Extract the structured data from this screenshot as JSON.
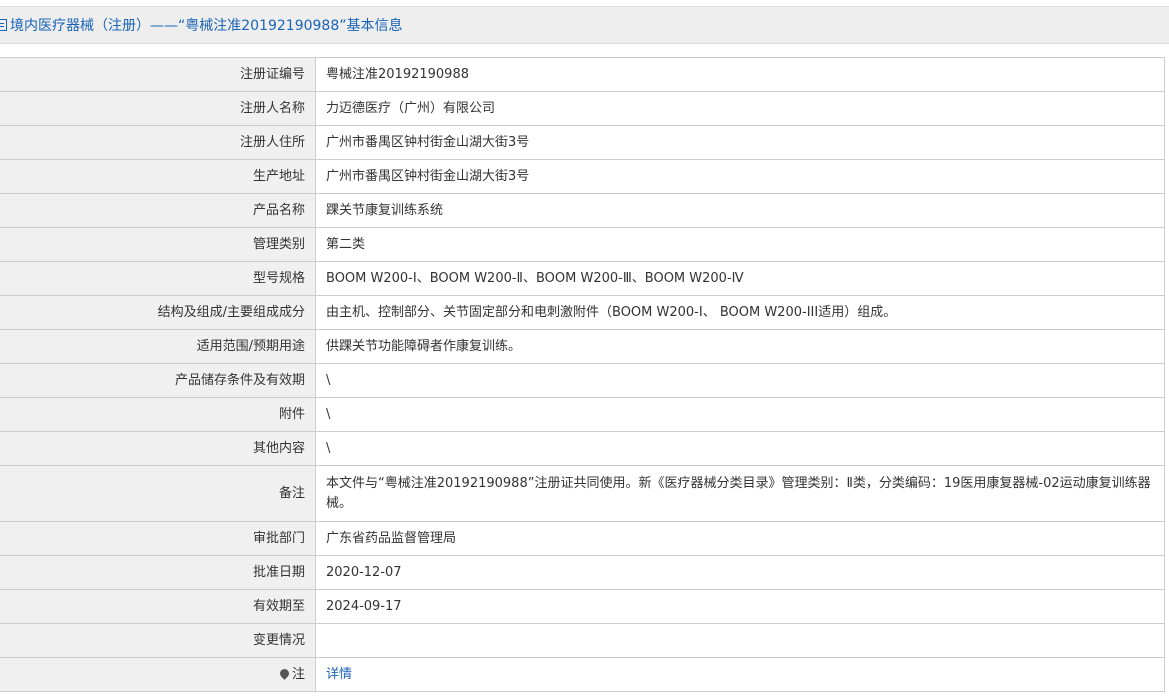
{
  "header": {
    "title": "境内医疗器械（注册）——“粤械注准20192190988”基本信息"
  },
  "rows": [
    {
      "label": "注册证编号",
      "value": "粤械注准20192190988"
    },
    {
      "label": "注册人名称",
      "value": "力迈德医疗（广州）有限公司"
    },
    {
      "label": "注册人住所",
      "value": "广州市番禺区钟村街金山湖大街3号"
    },
    {
      "label": "生产地址",
      "value": "广州市番禺区钟村街金山湖大街3号"
    },
    {
      "label": "产品名称",
      "value": "踝关节康复训练系统"
    },
    {
      "label": "管理类别",
      "value": "第二类"
    },
    {
      "label": "型号规格",
      "value": "BOOM W200-Ⅰ、BOOM W200-Ⅱ、BOOM W200-Ⅲ、BOOM W200-Ⅳ"
    },
    {
      "label": "结构及组成/主要组成成分",
      "value": "由主机、控制部分、关节固定部分和电刺激附件（BOOM W200-I、 BOOM W200-III适用）组成。"
    },
    {
      "label": "适用范围/预期用途",
      "value": "供踝关节功能障碍者作康复训练。"
    },
    {
      "label": "产品储存条件及有效期",
      "value": "\\"
    },
    {
      "label": "附件",
      "value": "\\"
    },
    {
      "label": "其他内容",
      "value": "\\"
    },
    {
      "label": "备注",
      "value": "本文件与“粤械注准20192190988”注册证共同使用。新《医疗器械分类目录》管理类别：Ⅱ类，分类编码：19医用康复器械-02运动康复训练器械。"
    },
    {
      "label": "审批部门",
      "value": "广东省药品监督管理局"
    },
    {
      "label": "批准日期",
      "value": "2020-12-07"
    },
    {
      "label": "有效期至",
      "value": "2024-09-17"
    },
    {
      "label": "变更情况",
      "value": ""
    }
  ],
  "note_row": {
    "label": "注",
    "link_text": "详情",
    "icon": "location-pin-icon"
  },
  "colors": {
    "title": "#1a64b7",
    "label_bg": "#f0f0f0",
    "border": "#cccccc",
    "link": "#1a64b7"
  }
}
